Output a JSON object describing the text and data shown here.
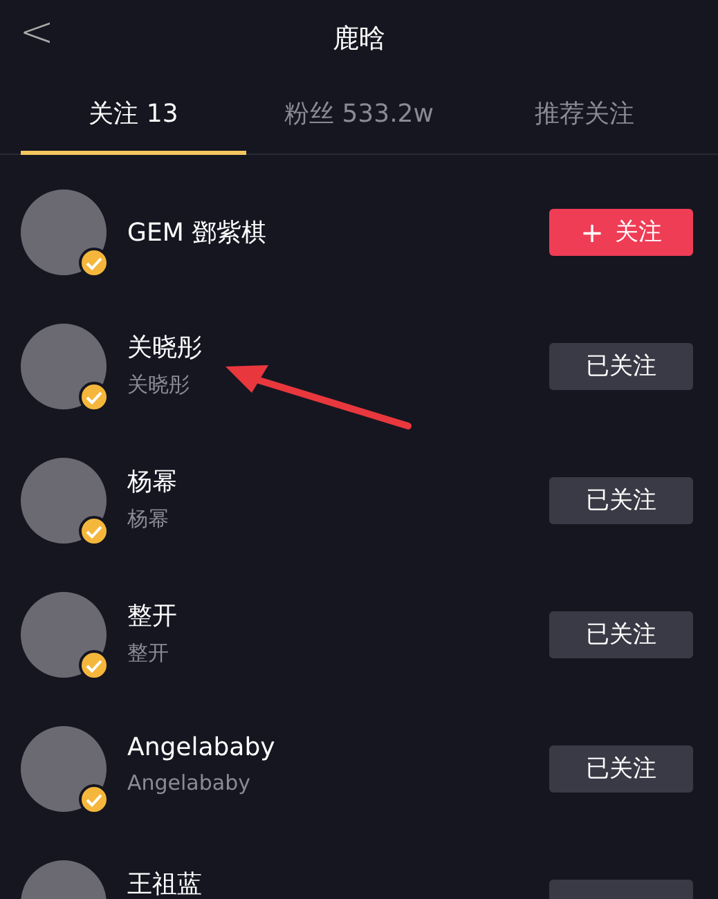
{
  "header": {
    "back": "<",
    "title": "鹿晗"
  },
  "tabs": [
    {
      "label": "关注 13",
      "selected": true
    },
    {
      "label": "粉丝 533.2w",
      "selected": false
    },
    {
      "label": "推荐关注",
      "selected": false
    }
  ],
  "users": [
    {
      "name": "GEM 鄧紫棋",
      "verified": true,
      "following": false,
      "button": "关注",
      "button_icon": "+"
    },
    {
      "name": "关晓彤",
      "subtitle": "关晓彤",
      "verified": true,
      "following": true,
      "button": "已关注"
    },
    {
      "name": "杨幂",
      "subtitle": "杨幂",
      "verified": true,
      "following": true,
      "button": "已关注"
    },
    {
      "name": "整开",
      "subtitle": "整开",
      "verified": true,
      "following": true,
      "button": "已关注"
    },
    {
      "name": "Angelababy",
      "subtitle": "Angelababy",
      "verified": true,
      "following": true,
      "button": "已关注"
    },
    {
      "name": "王祖蓝",
      "following": true
    }
  ],
  "annotation": {
    "kind": "arrow",
    "color": "#e8383d"
  }
}
